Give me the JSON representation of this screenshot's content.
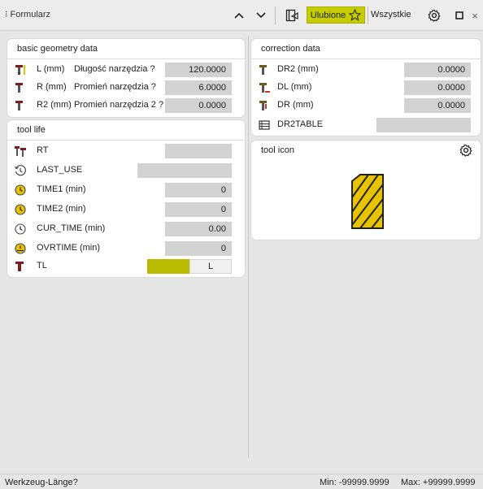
{
  "titlebar": {
    "title": "⁝ Formularz",
    "favorites_label": "Ulubione",
    "all_label": "Wszystkie"
  },
  "geometry": {
    "header": "basic geometry data",
    "rows": [
      {
        "code": "L (mm)",
        "desc": "Długość narzędzia ?",
        "value": "120.0000",
        "icon": "tool-length-icon"
      },
      {
        "code": "R (mm)",
        "desc": "Promień narzędzia ?",
        "value": "6.0000",
        "icon": "tool-radius-icon"
      },
      {
        "code": "R2 (mm)",
        "desc": "Promień narzędzia 2 ?",
        "value": "0.0000",
        "icon": "tool-radius2-icon"
      }
    ]
  },
  "toollife": {
    "header": "tool life",
    "rows": [
      {
        "label": "RT",
        "value": "",
        "icon": "replacement-tool-icon"
      },
      {
        "label": "LAST_USE",
        "value": "",
        "icon": "history-icon"
      },
      {
        "label": "TIME1 (min)",
        "value": "0",
        "icon": "clock-yellow-icon"
      },
      {
        "label": "TIME2 (min)",
        "value": "0",
        "icon": "clock-yellow-icon"
      },
      {
        "label": "CUR_TIME (min)",
        "value": "0.00",
        "icon": "clock-icon"
      },
      {
        "label": "OVRTIME (min)",
        "value": "0",
        "icon": "overtime-clock-icon"
      },
      {
        "label": "TL",
        "value": "L",
        "icon": "tool-locked-icon"
      }
    ]
  },
  "correction": {
    "header": "correction data",
    "rows": [
      {
        "label": "DR2 (mm)",
        "value": "0.0000",
        "icon": "delta-r2-icon"
      },
      {
        "label": "DL (mm)",
        "value": "0.0000",
        "icon": "delta-length-icon"
      },
      {
        "label": "DR (mm)",
        "value": "0.0000",
        "icon": "delta-radius-icon"
      },
      {
        "label": "DR2TABLE",
        "value": "",
        "icon": "table-icon"
      }
    ]
  },
  "toolicon": {
    "header": "tool icon"
  },
  "status": {
    "prompt": "Werkzeug-Länge?",
    "min": "Min: -99999.9999",
    "max": "Max: +99999.9999"
  },
  "colors": {
    "accent": "#c5cc00",
    "field": "#d2d2d2",
    "tool_yellow": "#e8c400"
  }
}
